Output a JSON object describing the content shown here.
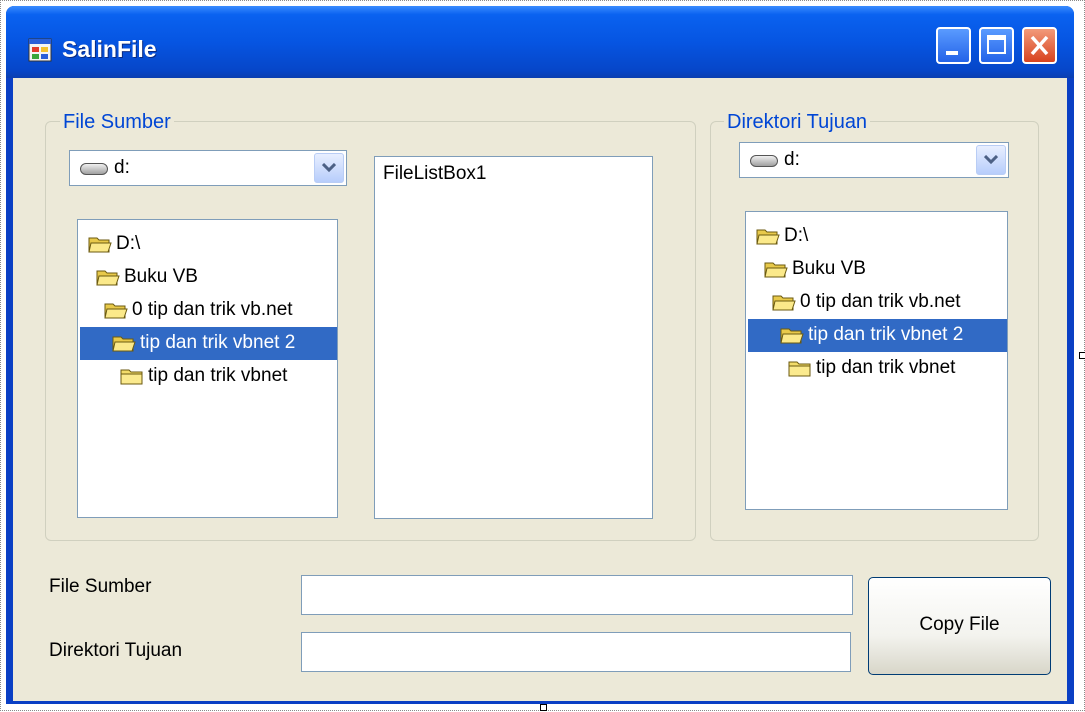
{
  "window": {
    "title": "SalinFile"
  },
  "source_group": {
    "label": "File Sumber",
    "drive": "d:",
    "folders": [
      {
        "label": "D:\\",
        "selected": false
      },
      {
        "label": "Buku VB",
        "selected": false
      },
      {
        "label": "0 tip dan trik vb.net",
        "selected": false
      },
      {
        "label": "tip dan trik vbnet 2",
        "selected": true
      },
      {
        "label": "tip dan trik vbnet",
        "selected": false
      }
    ],
    "file_list": "FileListBox1"
  },
  "dest_group": {
    "label": "Direktori Tujuan",
    "drive": "d:",
    "folders": [
      {
        "label": "D:\\",
        "selected": false
      },
      {
        "label": "Buku VB",
        "selected": false
      },
      {
        "label": "0 tip dan trik vb.net",
        "selected": false
      },
      {
        "label": "tip dan trik vbnet 2",
        "selected": true
      },
      {
        "label": "tip dan trik vbnet",
        "selected": false
      }
    ]
  },
  "form": {
    "source_label": "File Sumber",
    "source_value": "",
    "dest_label": "Direktori Tujuan",
    "dest_value": "",
    "copy_button": "Copy File"
  },
  "colors": {
    "selection": "#316ac5",
    "group_label": "#0046d5",
    "titlebar": "#0655e2"
  }
}
